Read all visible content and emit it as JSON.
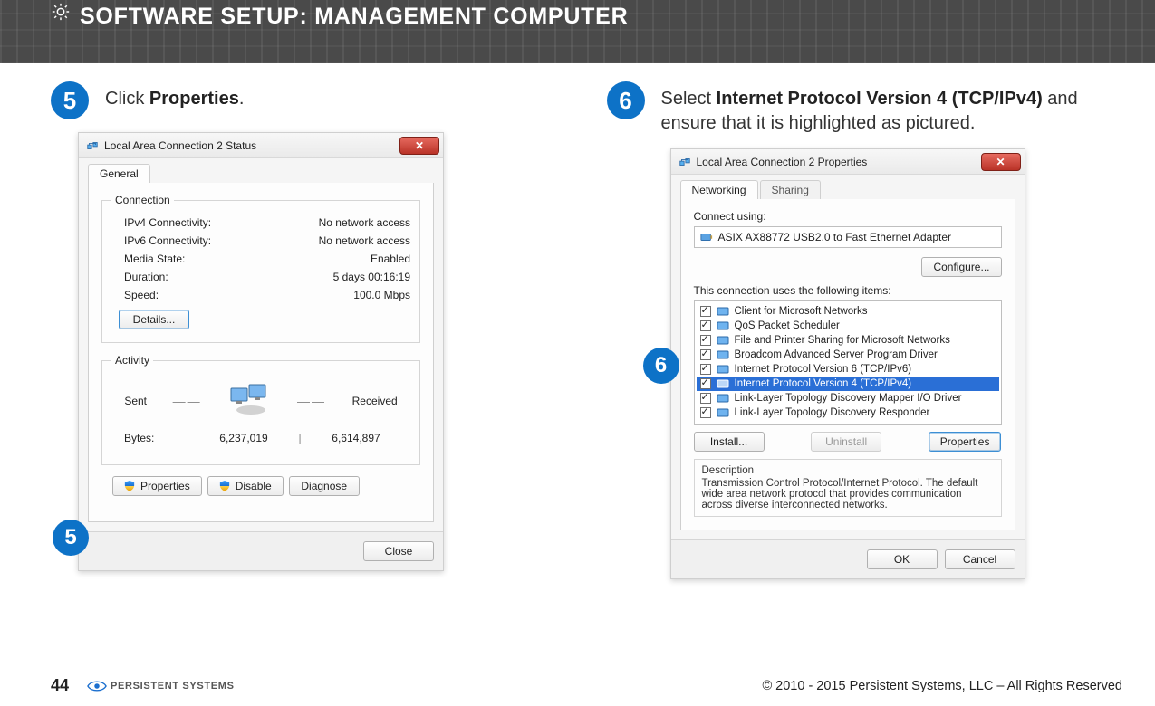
{
  "header": {
    "title": "SOFTWARE SETUP:  MANAGEMENT COMPUTER"
  },
  "step5": {
    "number": "5",
    "text_plain": "Click ",
    "text_bold": "Properties",
    "text_tail": "."
  },
  "step6": {
    "number": "6",
    "text_a": "Select ",
    "text_bold": "Internet Protocol Version 4 (TCP/IPv4)",
    "text_b": " and ensure that it is highlighted as pictured."
  },
  "statusDlg": {
    "title": "Local Area Connection 2 Status",
    "tab_general": "General",
    "grp_connection": "Connection",
    "rows": [
      {
        "k": "IPv4 Connectivity:",
        "v": "No network access"
      },
      {
        "k": "IPv6 Connectivity:",
        "v": "No network access"
      },
      {
        "k": "Media State:",
        "v": "Enabled"
      },
      {
        "k": "Duration:",
        "v": "5 days 00:16:19"
      },
      {
        "k": "Speed:",
        "v": "100.0 Mbps"
      }
    ],
    "details_btn": "Details...",
    "grp_activity": "Activity",
    "sent_label": "Sent",
    "recv_label": "Received",
    "bytes_label": "Bytes:",
    "bytes_sent": "6,237,019",
    "bytes_recv": "6,614,897",
    "btn_properties": "Properties",
    "btn_disable": "Disable",
    "btn_diagnose": "Diagnose",
    "btn_close": "Close",
    "callout": "5"
  },
  "propsDlg": {
    "title": "Local Area Connection 2 Properties",
    "tab_networking": "Networking",
    "tab_sharing": "Sharing",
    "connect_using": "Connect using:",
    "adapter": "ASIX AX88772 USB2.0 to Fast Ethernet Adapter",
    "configure_btn": "Configure...",
    "uses_label": "This connection uses the following items:",
    "items": [
      {
        "label": "Client for Microsoft Networks",
        "selected": false
      },
      {
        "label": "QoS Packet Scheduler",
        "selected": false
      },
      {
        "label": "File and Printer Sharing for Microsoft Networks",
        "selected": false
      },
      {
        "label": "Broadcom Advanced Server Program Driver",
        "selected": false
      },
      {
        "label": "Internet Protocol Version 6 (TCP/IPv6)",
        "selected": false
      },
      {
        "label": "Internet Protocol Version 4 (TCP/IPv4)",
        "selected": true
      },
      {
        "label": "Link-Layer Topology Discovery Mapper I/O Driver",
        "selected": false
      },
      {
        "label": "Link-Layer Topology Discovery Responder",
        "selected": false
      }
    ],
    "btn_install": "Install...",
    "btn_uninstall": "Uninstall",
    "btn_properties": "Properties",
    "desc_label": "Description",
    "desc_text": "Transmission Control Protocol/Internet Protocol. The default wide area network protocol that provides communication across diverse interconnected networks.",
    "btn_ok": "OK",
    "btn_cancel": "Cancel",
    "callout": "6"
  },
  "footer": {
    "page": "44",
    "brand": "PERSISTENT SYSTEMS",
    "copyright": "© 2010 - 2015 Persistent Systems, LLC – All Rights Reserved"
  }
}
